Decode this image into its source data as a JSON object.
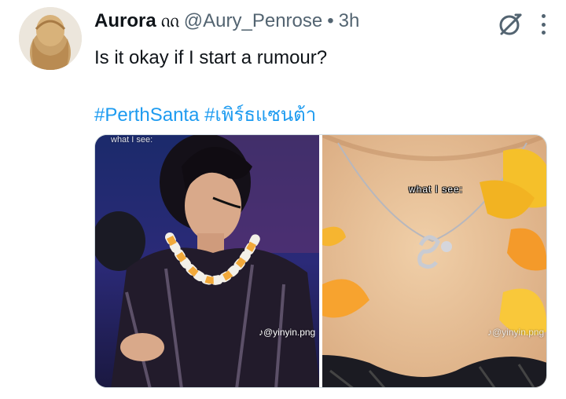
{
  "tweet": {
    "display_name": "Aurora",
    "name_glyph": "ᦶ",
    "handle": "@Aury_Penrose",
    "separator": "•",
    "time": "3h",
    "text": "Is it okay if I start a rumour?",
    "hashtags": [
      "#PerthSanta",
      "#เพิร์ธแซนต้า"
    ],
    "avatar_icon": "profile-photo"
  },
  "actions": {
    "grok_icon": "grok-icon",
    "more_icon": "more-icon"
  },
  "media": {
    "left": {
      "caption_top": "what I see:",
      "watermark": "♪@yinyin.png"
    },
    "right": {
      "caption": "what I see:",
      "watermark": "♪@yinyin.png"
    }
  },
  "colors": {
    "link": "#1d9bf0",
    "text": "#0f1419",
    "secondary": "#536471"
  }
}
